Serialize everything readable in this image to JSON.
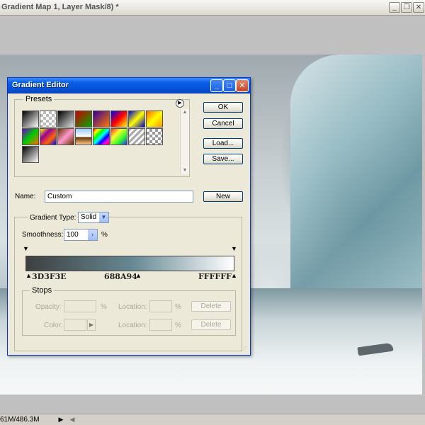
{
  "document": {
    "title": "Gradient Map 1, Layer Mask/8) *",
    "minimize_icon": "minimize-icon",
    "restore_icon": "restore-icon",
    "close_icon": "close-icon"
  },
  "status_bar": {
    "doc_size": "61M/486.3M"
  },
  "dialog": {
    "title": "Gradient Editor",
    "presets_label": "Presets",
    "buttons": {
      "ok": "OK",
      "cancel": "Cancel",
      "load": "Load...",
      "save": "Save...",
      "new": "New"
    },
    "name_label": "Name:",
    "name_value": "Custom",
    "gradient_type_label": "Gradient Type:",
    "gradient_type_value": "Solid",
    "smoothness_label": "Smoothness:",
    "smoothness_value": "100",
    "percent": "%",
    "stops": {
      "group_label": "Stops",
      "opacity_label": "Opacity:",
      "color_label": "Color:",
      "location_label": "Location:",
      "delete_label": "Delete"
    },
    "color_stops": [
      {
        "hex": "3D3F3E",
        "color": "#3d3f3e"
      },
      {
        "hex": "688A94",
        "color": "#688a94"
      },
      {
        "hex": "FFFFFF",
        "color": "#ffffff"
      }
    ],
    "presets": [
      "black-white",
      "transparent-checker",
      "black-grey",
      "red-green",
      "violet-orange",
      "blue-red-yellow",
      "blue-yellow-blue",
      "orange-yellow",
      "violet-green-orange",
      "yellow-violet-orange-blue",
      "copper",
      "chrome",
      "spectrum",
      "transparent-rainbow",
      "transparent-stripes",
      "checker-transparent",
      "black-white-small"
    ]
  }
}
